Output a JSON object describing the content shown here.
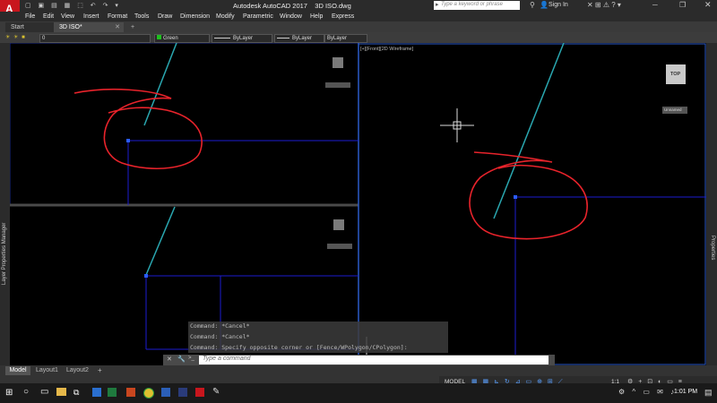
{
  "window": {
    "title": "Autodesk AutoCAD 2017    3D ISO.dwg",
    "app_icon_letter": "A",
    "search_placeholder": "Type a keyword or phrase",
    "sign_in": "Sign In"
  },
  "menu": [
    "File",
    "Edit",
    "View",
    "Insert",
    "Format",
    "Tools",
    "Draw",
    "Dimension",
    "Modify",
    "Parametric",
    "Window",
    "Help",
    "Express"
  ],
  "tabs": {
    "start": "Start",
    "active": "3D ISO*",
    "add": "+"
  },
  "properties": {
    "layer": "0",
    "color": "Green",
    "linetype": "ByLayer",
    "lineweight": "ByLayer",
    "plotstyle": "ByLayer"
  },
  "side_panels": {
    "left": "Layer Properties Manager",
    "right": "Properties"
  },
  "viewport": {
    "label": "[+][Front][2D Wireframe]",
    "viewcube_face": "TOP",
    "unnamed": "Unnamed"
  },
  "command": {
    "history": [
      "Command: *Cancel*",
      "Command: *Cancel*",
      "Command: Specify opposite corner or [Fence/WPolygon/CPolygon]:"
    ],
    "placeholder": "Type a command",
    "prompt_icon": ">_"
  },
  "layouts": {
    "model": "Model",
    "layout1": "Layout1",
    "layout2": "Layout2",
    "add": "+"
  },
  "status": {
    "model": "MODEL",
    "scale": "1:1"
  },
  "taskbar": {
    "time": "1:01 PM",
    "apps": [
      "windows-start",
      "search",
      "task-view",
      "file-explorer",
      "store",
      "excel",
      "powerpoint",
      "chrome",
      "word",
      "photoshop",
      "autocad",
      "paint"
    ]
  },
  "colors": {
    "annotation": "#e8232b",
    "construction_line": "#1b1bd0",
    "cyan_line": "#2aa7b0",
    "viewport_border": "#2b5ac8"
  }
}
